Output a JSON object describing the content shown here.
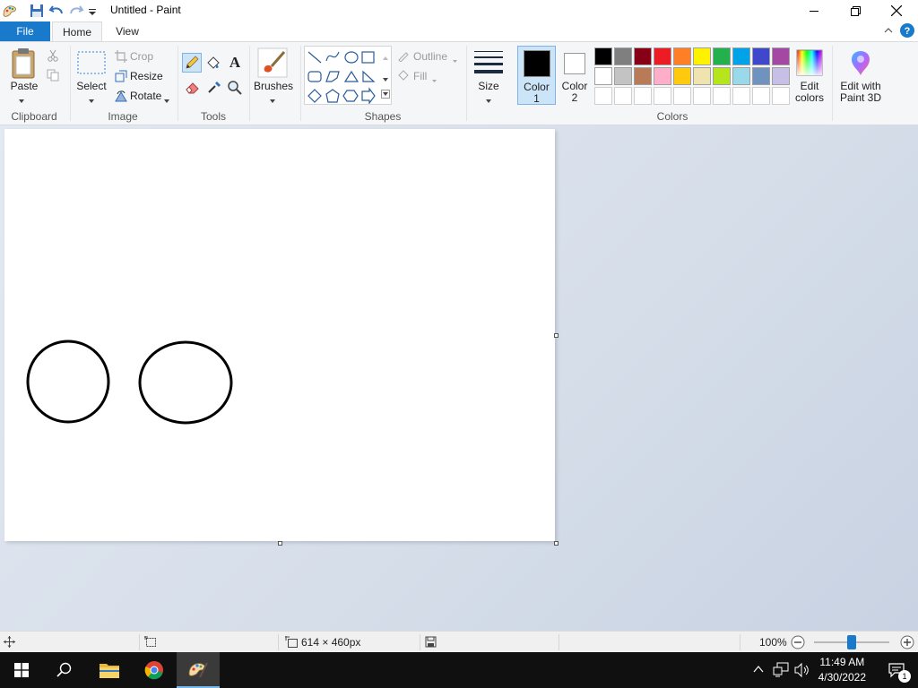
{
  "window": {
    "title": "Untitled - Paint"
  },
  "tabs": {
    "file": "File",
    "home": "Home",
    "view": "View"
  },
  "ribbon": {
    "clipboard": {
      "paste": "Paste",
      "label": "Clipboard"
    },
    "image": {
      "select": "Select",
      "crop": "Crop",
      "resize": "Resize",
      "rotate": "Rotate",
      "label": "Image"
    },
    "tools": {
      "label": "Tools"
    },
    "brushes": {
      "label": "Brushes"
    },
    "shapes": {
      "outline": "Outline",
      "fill": "Fill",
      "label": "Shapes"
    },
    "size": {
      "label": "Size"
    },
    "color1": {
      "line1": "Color",
      "line2": "1"
    },
    "color2": {
      "line1": "Color",
      "line2": "2"
    },
    "colors": {
      "label": "Colors",
      "edit_line1": "Edit",
      "edit_line2": "colors",
      "row1": [
        "#000000",
        "#7f7f7f",
        "#880015",
        "#ed1c24",
        "#ff7f27",
        "#fff200",
        "#22b14c",
        "#00a2e8",
        "#3f48cc",
        "#a349a4"
      ],
      "row2": [
        "#ffffff",
        "#c3c3c3",
        "#b97a57",
        "#ffaec9",
        "#ffc90e",
        "#efe4b0",
        "#b5e61d",
        "#99d9ea",
        "#7092be",
        "#c8bfe7"
      ],
      "color1_value": "#000000",
      "color2_value": "#ffffff"
    },
    "paint3d": {
      "line1": "Edit with",
      "line2": "Paint 3D"
    }
  },
  "status": {
    "canvas_size": "614 × 460px",
    "zoom": "100%",
    "zoom_fraction": 0.5
  },
  "taskbar": {
    "time": "11:49 AM",
    "date": "4/30/2022",
    "notifications": "1"
  },
  "colors": {
    "file_tab": "#1979ca",
    "selected_bg": "#cce4f7"
  }
}
